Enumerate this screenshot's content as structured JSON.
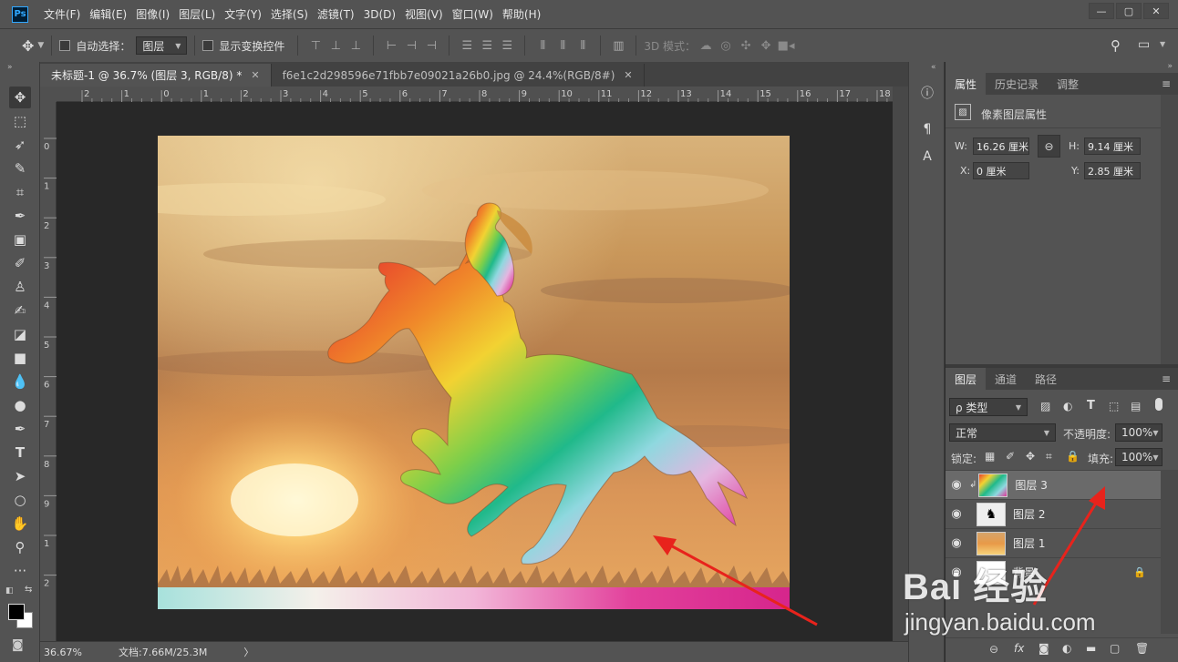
{
  "app": {
    "logo": "Ps"
  },
  "menu": [
    "文件(F)",
    "编辑(E)",
    "图像(I)",
    "图层(L)",
    "文字(Y)",
    "选择(S)",
    "滤镜(T)",
    "3D(D)",
    "视图(V)",
    "窗口(W)",
    "帮助(H)"
  ],
  "options": {
    "auto_select_label": "自动选择：",
    "auto_select_value": "图层",
    "show_transform_label": "显示变换控件",
    "mode_3d_label": "3D 模式："
  },
  "tabs": [
    {
      "label": "未标题-1 @ 36.7% (图层 3, RGB/8) *",
      "active": true
    },
    {
      "label": "f6e1c2d298596e71fbb7e09021a26b0.jpg @ 24.4%(RGB/8#)",
      "active": false
    }
  ],
  "ruler": {
    "h_ticks": [
      "2",
      "1",
      "0",
      "1",
      "2",
      "3",
      "4",
      "5",
      "6",
      "7",
      "8",
      "9",
      "10",
      "11",
      "12",
      "13",
      "14",
      "15",
      "16",
      "17",
      "18"
    ],
    "v_ticks": [
      "0",
      "1",
      "2",
      "3",
      "4",
      "5",
      "6",
      "7",
      "8",
      "9",
      "1",
      "2"
    ]
  },
  "status": {
    "zoom": "36.67%",
    "doc": "文档:7.66M/25.3M",
    "arrow": "〉"
  },
  "properties": {
    "tabs": [
      "属性",
      "历史记录",
      "调整"
    ],
    "title": "像素图层属性",
    "w_label": "W:",
    "w_value": "16.26 厘米",
    "h_label": "H:",
    "h_value": "9.14 厘米",
    "x_label": "X:",
    "x_value": "0 厘米",
    "y_label": "Y:",
    "y_value": "2.85 厘米"
  },
  "layers": {
    "tabs": [
      "图层",
      "通道",
      "路径"
    ],
    "filter_label": "ρ 类型",
    "blend_mode": "正常",
    "opacity_label": "不透明度:",
    "opacity_value": "100%",
    "lock_label": "锁定:",
    "fill_label": "填充:",
    "fill_value": "100%",
    "items": [
      {
        "name": "图层 3",
        "selected": true
      },
      {
        "name": "图层 2",
        "selected": false
      },
      {
        "name": "图层 1",
        "selected": false
      },
      {
        "name": "背景",
        "selected": false
      }
    ],
    "footer_fx": "fx"
  },
  "watermark": {
    "brand": "Bai 经验",
    "url": "jingyan.baidu.com"
  },
  "colors": {
    "chrome": "#535353",
    "canvas_bg": "#282828",
    "accent": "#31a8ff",
    "arrow": "#e8231c"
  }
}
